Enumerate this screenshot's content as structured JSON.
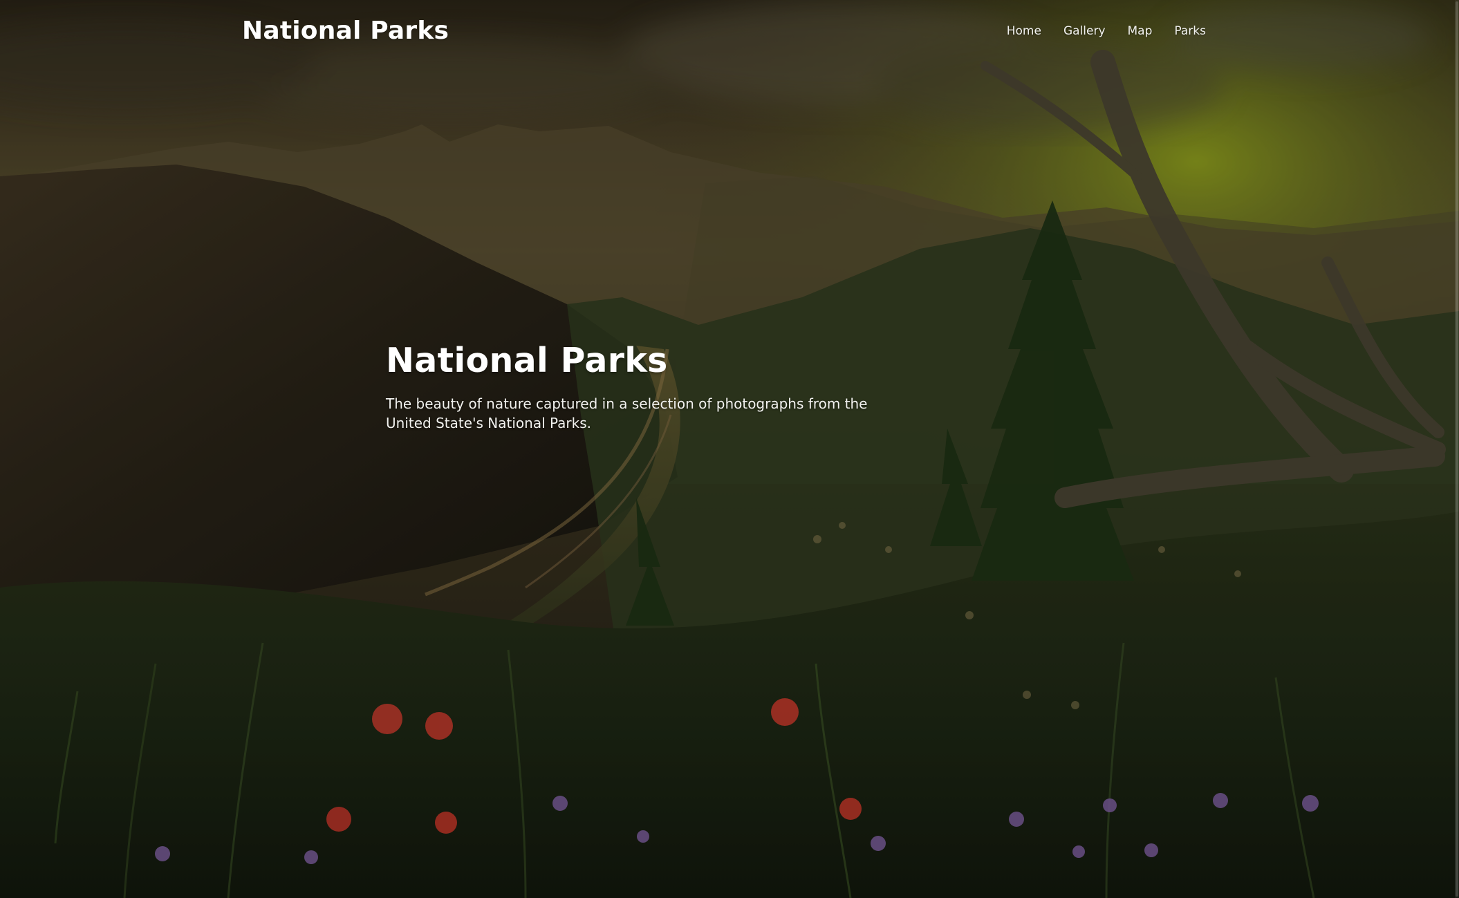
{
  "header": {
    "logo": "National Parks",
    "nav": [
      {
        "label": "Home"
      },
      {
        "label": "Gallery"
      },
      {
        "label": "Map"
      },
      {
        "label": "Parks"
      }
    ]
  },
  "hero": {
    "title": "National Parks",
    "subtitle": "The beauty of nature captured in a selection of photographs from the United State's National Parks."
  },
  "colors": {
    "text": "#ffffff",
    "overlay": "#151411",
    "sky_glow": "#8da321",
    "flower_red": "#d53b2d",
    "flower_purple": "#8e6bb5"
  },
  "icons": [
    "scrollbar"
  ]
}
